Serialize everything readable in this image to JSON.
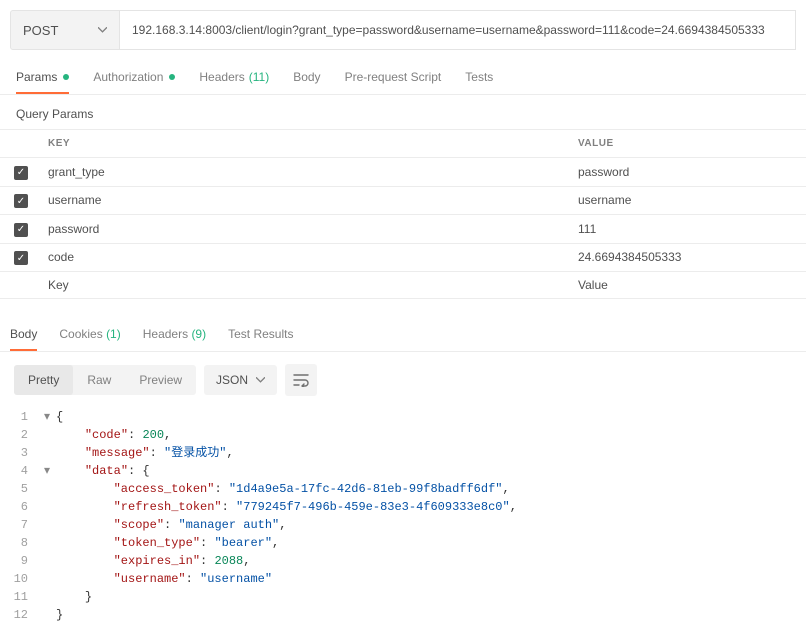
{
  "request": {
    "method": "POST",
    "url": "192.168.3.14:8003/client/login?grant_type=password&username=username&password=111&code=24.6694384505333"
  },
  "reqTabs": {
    "params": "Params",
    "authorization": "Authorization",
    "headers": "Headers",
    "headersCount": "(11)",
    "body": "Body",
    "preRequest": "Pre-request Script",
    "tests": "Tests"
  },
  "queryParams": {
    "title": "Query Params",
    "headerKey": "KEY",
    "headerValue": "VALUE",
    "rows": [
      {
        "key": "grant_type",
        "value": "password"
      },
      {
        "key": "username",
        "value": "username"
      },
      {
        "key": "password",
        "value": "111"
      },
      {
        "key": "code",
        "value": "24.6694384505333"
      }
    ],
    "placeholderKey": "Key",
    "placeholderValue": "Value"
  },
  "respTabs": {
    "body": "Body",
    "cookies": "Cookies",
    "cookiesCount": "(1)",
    "headers": "Headers",
    "headersCount": "(9)",
    "testResults": "Test Results"
  },
  "toolbar": {
    "pretty": "Pretty",
    "raw": "Raw",
    "preview": "Preview",
    "format": "JSON"
  },
  "response": {
    "lines": [
      {
        "n": 1,
        "indent": 0,
        "fold": true,
        "tokens": [
          {
            "t": "punc",
            "v": "{"
          }
        ]
      },
      {
        "n": 2,
        "indent": 1,
        "tokens": [
          {
            "t": "key",
            "v": "\"code\""
          },
          {
            "t": "punc",
            "v": ": "
          },
          {
            "t": "num",
            "v": "200"
          },
          {
            "t": "punc",
            "v": ","
          }
        ]
      },
      {
        "n": 3,
        "indent": 1,
        "tokens": [
          {
            "t": "key",
            "v": "\"message\""
          },
          {
            "t": "punc",
            "v": ": "
          },
          {
            "t": "str",
            "v": "\"登录成功\""
          },
          {
            "t": "punc",
            "v": ","
          }
        ]
      },
      {
        "n": 4,
        "indent": 1,
        "fold": true,
        "tokens": [
          {
            "t": "key",
            "v": "\"data\""
          },
          {
            "t": "punc",
            "v": ": {"
          }
        ]
      },
      {
        "n": 5,
        "indent": 2,
        "tokens": [
          {
            "t": "key",
            "v": "\"access_token\""
          },
          {
            "t": "punc",
            "v": ": "
          },
          {
            "t": "str",
            "v": "\"1d4a9e5a-17fc-42d6-81eb-99f8badff6df\""
          },
          {
            "t": "punc",
            "v": ","
          }
        ]
      },
      {
        "n": 6,
        "indent": 2,
        "tokens": [
          {
            "t": "key",
            "v": "\"refresh_token\""
          },
          {
            "t": "punc",
            "v": ": "
          },
          {
            "t": "str",
            "v": "\"779245f7-496b-459e-83e3-4f609333e8c0\""
          },
          {
            "t": "punc",
            "v": ","
          }
        ]
      },
      {
        "n": 7,
        "indent": 2,
        "tokens": [
          {
            "t": "key",
            "v": "\"scope\""
          },
          {
            "t": "punc",
            "v": ": "
          },
          {
            "t": "str",
            "v": "\"manager auth\""
          },
          {
            "t": "punc",
            "v": ","
          }
        ]
      },
      {
        "n": 8,
        "indent": 2,
        "tokens": [
          {
            "t": "key",
            "v": "\"token_type\""
          },
          {
            "t": "punc",
            "v": ": "
          },
          {
            "t": "str",
            "v": "\"bearer\""
          },
          {
            "t": "punc",
            "v": ","
          }
        ]
      },
      {
        "n": 9,
        "indent": 2,
        "tokens": [
          {
            "t": "key",
            "v": "\"expires_in\""
          },
          {
            "t": "punc",
            "v": ": "
          },
          {
            "t": "num",
            "v": "2088"
          },
          {
            "t": "punc",
            "v": ","
          }
        ]
      },
      {
        "n": 10,
        "indent": 2,
        "tokens": [
          {
            "t": "key",
            "v": "\"username\""
          },
          {
            "t": "punc",
            "v": ": "
          },
          {
            "t": "str",
            "v": "\"username\""
          }
        ]
      },
      {
        "n": 11,
        "indent": 1,
        "tokens": [
          {
            "t": "punc",
            "v": "}"
          }
        ]
      },
      {
        "n": 12,
        "indent": 0,
        "tokens": [
          {
            "t": "punc",
            "v": "}"
          }
        ]
      }
    ]
  }
}
